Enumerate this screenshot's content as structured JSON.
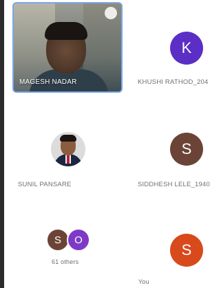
{
  "participants": {
    "video": {
      "name": "MAGESH NADAR"
    },
    "khushi": {
      "initial": "K",
      "name": "KHUSHI RATHOD_204",
      "color": "#5b2fc6"
    },
    "sunil": {
      "name": "SUNIL PANSARE"
    },
    "siddhesh": {
      "initial": "S",
      "name": "SIDDHESH LELE_1940",
      "color": "#6b4437"
    },
    "others": {
      "avatars": [
        {
          "initial": "S",
          "color": "#6b4437"
        },
        {
          "initial": "O",
          "color": "#7e3ac7"
        }
      ],
      "label": "61 others"
    },
    "you": {
      "initial": "S",
      "label": "You",
      "color": "#d84a1b"
    }
  }
}
